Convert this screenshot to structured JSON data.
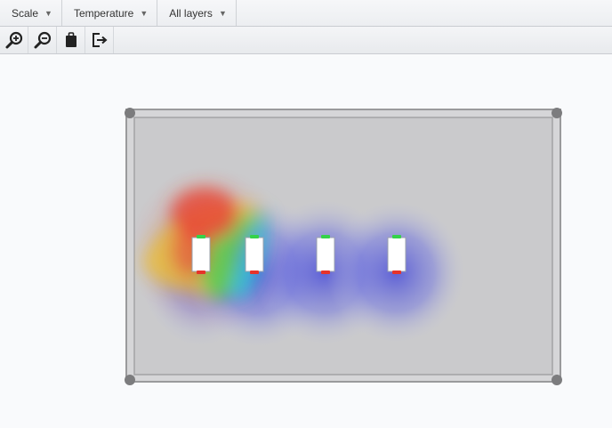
{
  "menubar": {
    "scale_label": "Scale",
    "temperature_label": "Temperature",
    "layers_label": "All layers",
    "dropdown_glyph": "▼"
  },
  "toolbar": {
    "icons": [
      "zoom-in-icon",
      "zoom-out-icon",
      "clipboard-icon",
      "exit-icon"
    ]
  },
  "heatmap": {
    "colors": {
      "hot": "#e84a3a",
      "warm": "#f0b52a",
      "mid": "#4ccf55",
      "cool": "#2ec6d8",
      "cold": "#4a50d8",
      "enclosure": "#cacacc",
      "frame": "#a9a9ab",
      "positive_terminal": "#35d24a",
      "negative_terminal": "#e6332a"
    },
    "cells": [
      {
        "id": "cell-1",
        "temperature_level": "hot"
      },
      {
        "id": "cell-2",
        "temperature_level": "cold"
      },
      {
        "id": "cell-3",
        "temperature_level": "cold"
      },
      {
        "id": "cell-4",
        "temperature_level": "cold"
      }
    ]
  }
}
